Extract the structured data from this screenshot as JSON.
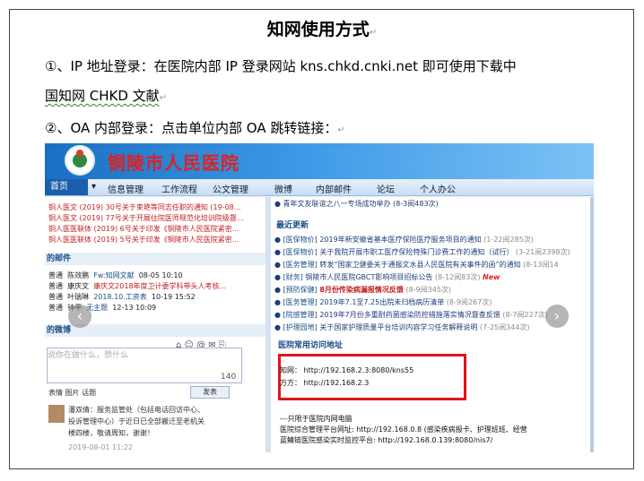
{
  "document": {
    "title": "知网使用方式",
    "para1_line1": "①、IP 地址登录：在医院内部 IP 登录网站 kns.chkd.cnki.net 即可使用下载中",
    "para1_line2": "国知网 CHKD 文献",
    "para2": "②、OA 内部登录：点击单位内部 OA 跳转链接："
  },
  "screenshot": {
    "hospital_name": "铜陵市人民医院",
    "nav": {
      "home": "首页",
      "dropdown": "▾",
      "items": [
        "信息管理",
        "工作流程",
        "公文管理",
        "微博",
        "内部邮件",
        "论坛",
        "个人办公"
      ]
    },
    "left_notices": [
      "铜人医文 (2019) 30号关于束艳等同志任职的通知 (19-08...",
      "铜人医文 (2019) 77号关于开展住院医师规范化培训院级督...",
      "铜人医医联体 (2019) 6号关于印发《铜陵市人民医院紧密...",
      "铜人医医联体 (2019) 5号关于印发《铜陵市人民医院紧密..."
    ],
    "mail_section": "的邮件",
    "mail_rows": [
      {
        "type": "普通",
        "sender": "陈效鹏",
        "subject": "Fw:知网文献",
        "date": "08-05 10:10"
      },
      {
        "type": "普通",
        "sender": "康庆文",
        "subject": "康庆文2018年度卫计委学科带头人考核...",
        "date": ""
      },
      {
        "type": "普通",
        "sender": "叶瑞琳",
        "subject": "2018.10.工资表",
        "date": "10-19 15:52"
      },
      {
        "type": "普通",
        "sender": "钟平",
        "subject": "无主题",
        "date": "12-13 10:09"
      }
    ],
    "weibo_section": "的微博",
    "weibo_placeholder": "说你在做什么，想什么",
    "weibo_count": "140",
    "weibo_tools": "表情    图片    话题",
    "send_label": "发表",
    "weibo_post_line1": "潘双倩：服务监管处（包括电话回访中心、",
    "weibo_post_line2": "投诉管理中心）于近日已全部搬迁至老机关",
    "weibo_post_line3": "楼四楼，敬请周知，谢谢！",
    "weibo_post_time": "2019-08-01 11:22",
    "top_news": "青年文友联谊之八一专场成功举办 (8-3阅483次)",
    "news_section": "最近更新",
    "news": [
      {
        "cat": "[医保物价]",
        "text": "2019年新安徽省基本医疗保险医疗服务项目的通知",
        "meta": "(1-22阅285次)"
      },
      {
        "cat": "[医保物价]",
        "text": "关于我院开展市职工医疗保险特殊门诊费工作的通知（试行）",
        "meta": "(3-21阅2398次)"
      },
      {
        "cat": "[医务管理]",
        "text": "转发“国家卫健委关于通报文水县人民医院有关事件的函”的通知",
        "meta": "(8-13阅14"
      },
      {
        "cat": "[财务]",
        "text": "铜陵市人民医院GBCT影响项目招标公告",
        "meta": "(8-12阅83次)",
        "tag": "New"
      },
      {
        "cat": "[预防保健]",
        "text": "8月份传染病漏报情况反馈",
        "meta": "(8-9阅345次)"
      },
      {
        "cat": "[医务管理]",
        "text": "2019年7.1至7.25出院未归档病历清单",
        "meta": "(8-9阅267次)"
      },
      {
        "cat": "[院感管理]",
        "text": "2019年7月份多重耐药菌感染防控措施落实情况督查反馈",
        "meta": "(8-7阅227次)"
      },
      {
        "cat": "[护理园地]",
        "text": "关于国家护理质量平台培训内容学习任务解释说明",
        "meta": "(7-25阅344次)"
      }
    ],
    "access_section": "医院常用访问地址",
    "addr_cnki": "知网： http://192.168.2.3:8080/kns55",
    "addr_wanfang": "万方： http://192.168.2.3",
    "intranet_note": "---只限于医院内网电脑",
    "platform_line1": "医院综合管理平台网址: http://192.168.0.8 (感染疾病报卡、护理班班、经营",
    "platform_line2": "蓝鲭链医院感染实时监控平台: http://192.168.0.139:8080/nis7/"
  }
}
